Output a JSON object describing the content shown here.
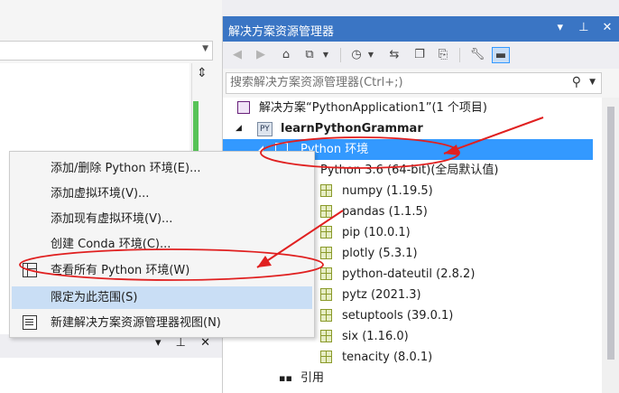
{
  "solution_explorer": {
    "title": "解决方案资源管理器",
    "title_controls": [
      "▾",
      "⊥",
      "✕"
    ],
    "search_placeholder": "搜索解决方案资源管理器(Ctrl+;)",
    "tree": {
      "solution": "解决方案“PythonApplication1”(1 个项目)",
      "project": "learnPythonGrammar",
      "project_badge": "PY",
      "python_env": "Python 环境",
      "interpreter": "Python 3.6 (64-bit)(全局默认值)",
      "packages": [
        "numpy (1.19.5)",
        "pandas (1.1.5)",
        "pip (10.0.1)",
        "plotly (5.3.1)",
        "python-dateutil (2.8.2)",
        "pytz (2021.3)",
        "setuptools (39.0.1)",
        "six (1.16.0)",
        "tenacity (8.0.1)"
      ],
      "references": "引用"
    }
  },
  "context_menu": {
    "items": [
      "添加/删除 Python 环境(E)...",
      "添加虚拟环境(V)...",
      "添加现有虚拟环境(V)...",
      "创建 Conda 环境(C)...",
      "查看所有 Python 环境(W)",
      "限定为此范围(S)",
      "新建解决方案资源管理器视图(N)"
    ]
  },
  "left_panel": {
    "bottom_controls": "▾ ⊥ ✕"
  },
  "colors": {
    "title_bar": "#3a75c4",
    "selection": "#3399ff",
    "menu_hover": "#c9def5",
    "annotation": "#e02020"
  }
}
